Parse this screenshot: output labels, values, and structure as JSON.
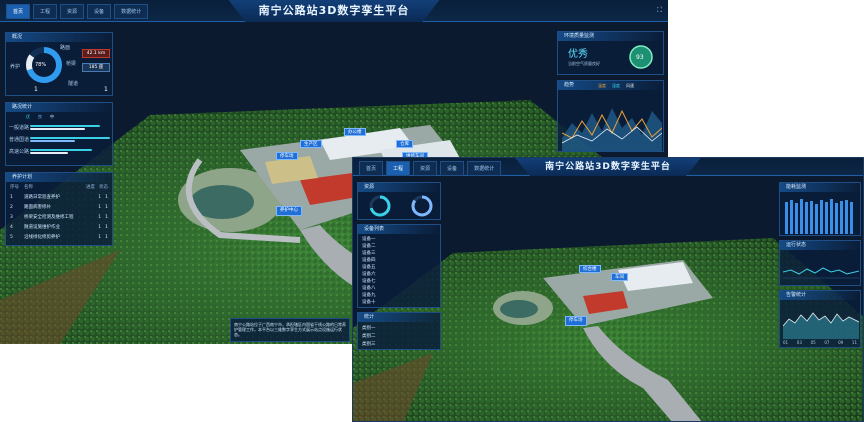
{
  "main": {
    "title": "南宁公路站3D数字孪生平台",
    "tabs": [
      "首页",
      "工程",
      "资源",
      "设备",
      "数据统计"
    ],
    "fullscreen_icon": "⛶",
    "left_panels": {
      "p1": {
        "header": "概况",
        "center": "78%",
        "labels": [
          "养护",
          "路面",
          "桥梁",
          "隧道"
        ],
        "btn1": "42.1 km",
        "btn2": "185 座",
        "stat1": "1",
        "stat2": "1"
      },
      "p2": {
        "header": "路况统计",
        "legend": [
          "优",
          "良",
          "中"
        ],
        "rows": [
          "一般道路",
          "普通国道",
          "高速公路"
        ]
      },
      "p3": {
        "header": "养护计划",
        "cols": [
          "序号",
          "名称",
          "进度",
          "状态"
        ],
        "rows": [
          [
            "1",
            "道路日常巡查养护",
            "1",
            "1"
          ],
          [
            "2",
            "路面病害修补",
            "1",
            "1"
          ],
          [
            "3",
            "桥梁安全检测及维修工程",
            "1",
            "1"
          ],
          [
            "4",
            "隧道设施维护作业",
            "1",
            "1"
          ],
          [
            "5",
            "沿线绿化修剪养护",
            "1",
            "1"
          ]
        ]
      }
    },
    "right_panels": {
      "p1": {
        "header": "环境质量监测",
        "rating": "优秀",
        "score": "93",
        "sub": "当前空气质量良好"
      },
      "p2": {
        "header": "趋势",
        "legend": [
          "温度",
          "湿度",
          "风速"
        ]
      }
    },
    "map_tags": [
      "办公楼",
      "生产区",
      "仓库",
      "停车场",
      "维修车间",
      "养护中心"
    ],
    "bottom_note": "南宁公路站位于广西南宁市，承担辖区内国省干线公路的日常养护管理工作，本平台以三维数字孪生方式展示站点设施运行状态。"
  },
  "second": {
    "title": "南宁公路站3D数字孪生平台",
    "tabs": [
      "首页",
      "工程",
      "资源",
      "设备",
      "数据统计"
    ],
    "left_panels": {
      "p1": {
        "header": "资源"
      },
      "p2": {
        "header": "设备列表",
        "rows": [
          "设备一",
          "设备二",
          "设备三",
          "设备四",
          "设备五",
          "设备六",
          "设备七",
          "设备八",
          "设备九",
          "设备十"
        ]
      },
      "p3": {
        "header": "统计",
        "rows": [
          "类别一",
          "类别二",
          "类别三"
        ]
      }
    },
    "right_panels": {
      "p1": {
        "header": "能耗监测"
      },
      "p2": {
        "header": "运行状态"
      },
      "p3": {
        "header": "告警统计",
        "axis": [
          "01",
          "03",
          "05",
          "07",
          "09",
          "11"
        ]
      }
    },
    "map_tags": [
      "综合楼",
      "车间",
      "停车场"
    ]
  },
  "colors": {
    "accent": "#1f6fd6",
    "green": "#3fa24c",
    "cyan": "#3ad1e6",
    "orange": "#f0a23a",
    "red": "#c0392b"
  }
}
